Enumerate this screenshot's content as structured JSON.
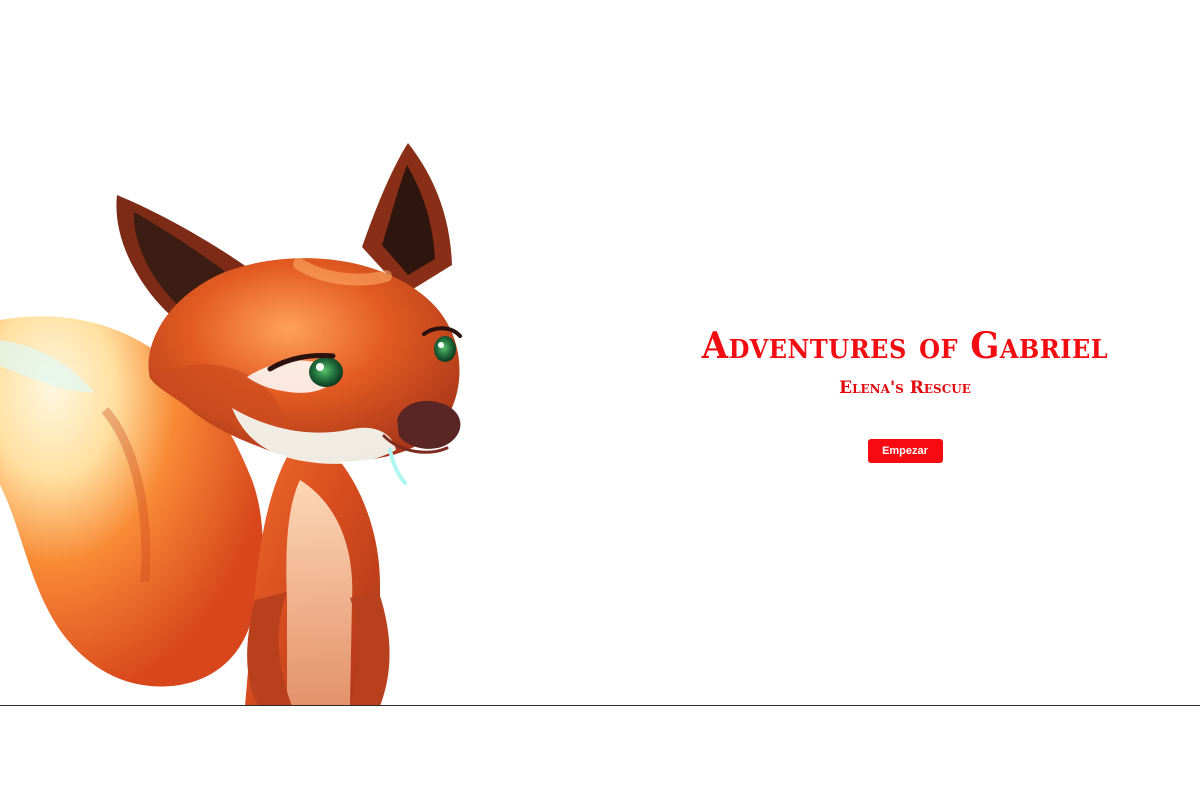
{
  "title_screen": {
    "title": "Adventures of Gabriel",
    "subtitle": "Elena's Rescue",
    "start_button_label": "Empezar"
  },
  "character": {
    "name": "fox-character",
    "colors": {
      "fur_primary": "#e35b22",
      "fur_dark": "#8f2f16",
      "fur_light": "#fff2d6",
      "ear_inner": "#3b1d13",
      "nose": "#5a2525",
      "eye": "#1f6b3b",
      "highlight": "#aef6f0"
    }
  },
  "colors": {
    "accent": "#f20d12",
    "button_bg": "#f70a11",
    "button_text": "#ffffff",
    "background": "#ffffff"
  }
}
